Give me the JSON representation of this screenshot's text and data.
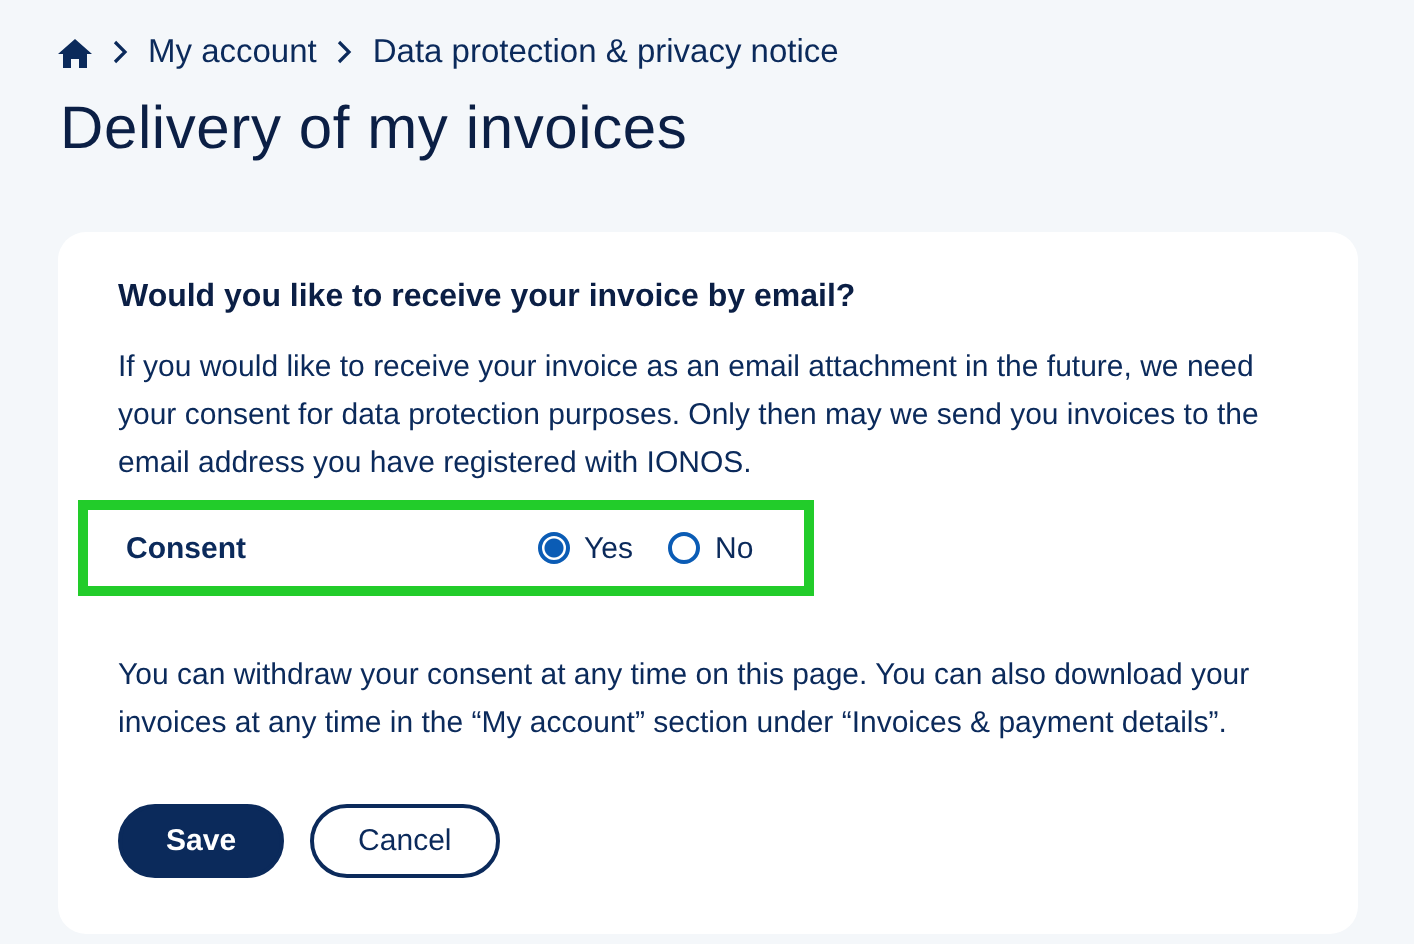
{
  "breadcrumb": [
    {
      "label": "My account"
    },
    {
      "label": "Data protection & privacy notice"
    }
  ],
  "title": "Delivery of my invoices",
  "card": {
    "heading": "Would you like to receive your invoice by email?",
    "intro": "If you would like to receive your invoice as an email attachment in the future, we need your consent for data protection purposes. Only then may we send you invoices to the email address you have registered with IONOS.",
    "consent": {
      "label": "Consent",
      "highlighted": true,
      "options": [
        {
          "label": "Yes",
          "selected": true
        },
        {
          "label": "No",
          "selected": false
        }
      ]
    },
    "note": "You can withdraw your consent at any time on this page. You can also download your invoices at any time in the “My account” section under “Invoices & payment details”.",
    "buttons": [
      {
        "label": "Save",
        "kind": "primary"
      },
      {
        "label": "Cancel",
        "kind": "secondary"
      }
    ]
  }
}
